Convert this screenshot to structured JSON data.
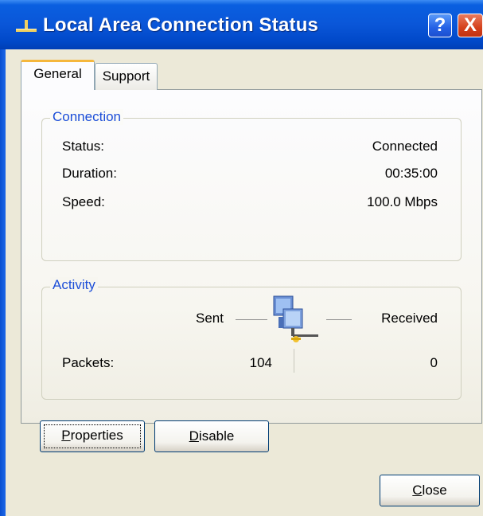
{
  "window": {
    "title": "Local Area Connection Status",
    "help_button": "?",
    "close_button": "X"
  },
  "tabs": [
    {
      "label": "General",
      "selected": true
    },
    {
      "label": "Support",
      "selected": false
    }
  ],
  "connection": {
    "legend": "Connection",
    "rows": [
      {
        "label": "Status:",
        "value": "Connected"
      },
      {
        "label": "Duration:",
        "value": "00:35:00"
      },
      {
        "label": "Speed:",
        "value": "100.0 Mbps"
      }
    ]
  },
  "activity": {
    "legend": "Activity",
    "sent_label": "Sent",
    "received_label": "Received",
    "packets_label": "Packets:",
    "packets_sent": "104",
    "packets_received": "0"
  },
  "buttons": {
    "properties": {
      "mnemonic": "P",
      "rest": "roperties"
    },
    "disable": {
      "mnemonic": "D",
      "rest": "isable"
    },
    "close": {
      "mnemonic": "C",
      "rest": "lose"
    }
  },
  "icons": {
    "title_icon": "network-connection-icon",
    "activity_icon": "network-activity-icon"
  },
  "colors": {
    "titlebar": "#0a56d8",
    "tab_highlight": "#f5b73c",
    "legend_text": "#1c4ed8",
    "window_bg": "#ece9d8"
  }
}
